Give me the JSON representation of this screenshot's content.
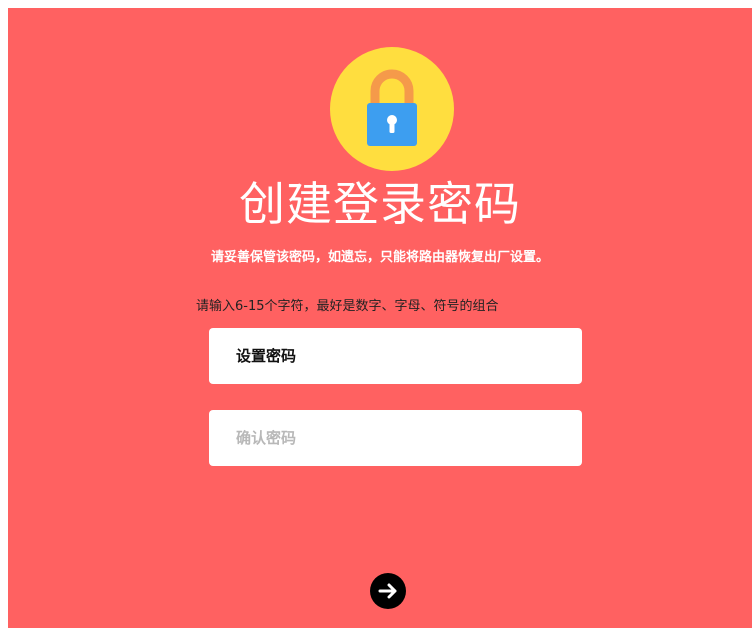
{
  "page": {
    "title": "创建登录密码",
    "warning": "请妥善保管该密码，如遗忘，只能将路由器恢复出厂设置。",
    "hint": "请输入6-15个字符，最好是数字、字母、符号的组合"
  },
  "form": {
    "password_placeholder": "设置密码",
    "confirm_placeholder": "确认密码"
  },
  "icons": {
    "lock": "lock-icon",
    "next": "arrow-right-icon"
  },
  "colors": {
    "background": "#ff6161",
    "lock_circle": "#ffde3f",
    "lock_shackle": "#f59a4a",
    "lock_body": "#3d9ef0",
    "button": "#000000"
  }
}
